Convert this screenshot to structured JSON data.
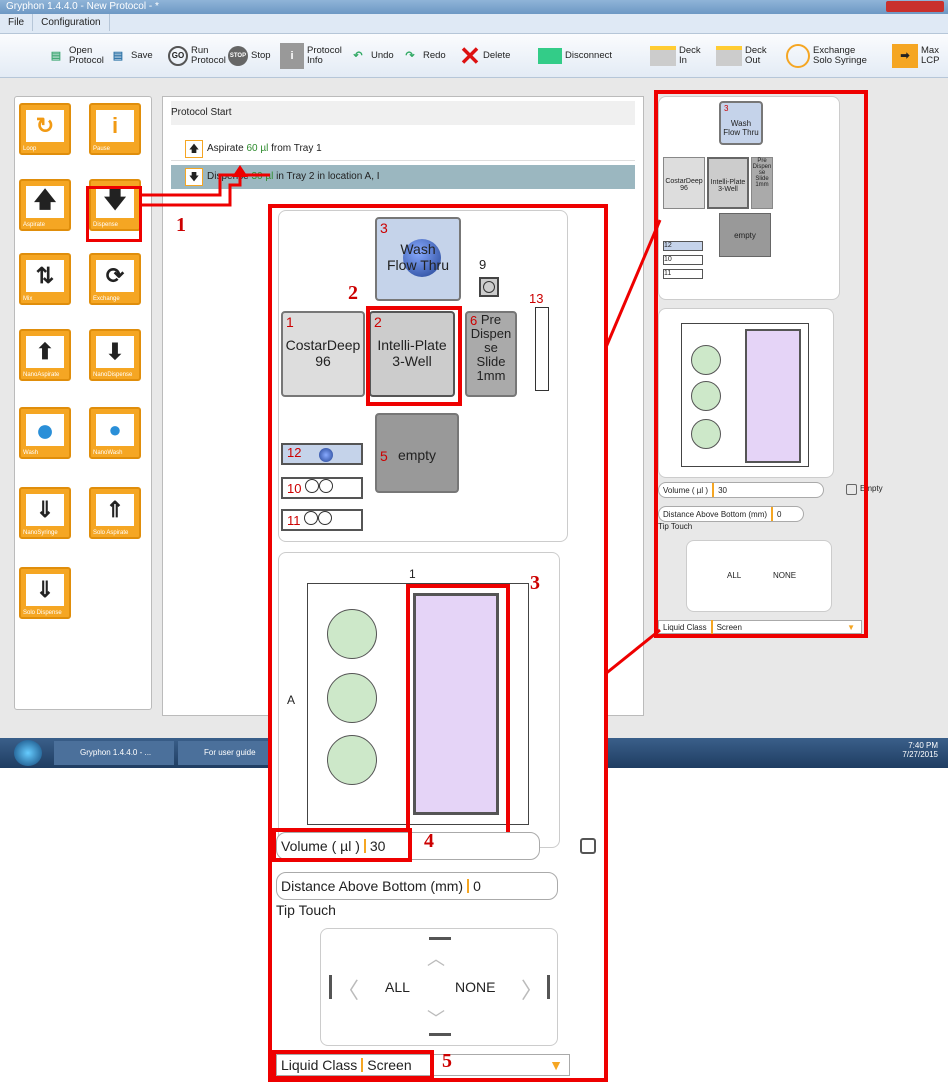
{
  "window": {
    "title": "Gryphon 1.4.4.0 - New Protocol - *"
  },
  "menu": [
    "File",
    "Configuration"
  ],
  "toolbar": [
    {
      "label": "Open\nProtocol",
      "icon": "open-icon"
    },
    {
      "label": "Save",
      "icon": "save-icon"
    },
    {
      "label": "Run\nProtocol",
      "icon": "go-icon",
      "glyph": "GO"
    },
    {
      "label": "Stop",
      "icon": "stop-icon",
      "glyph": "STOP"
    },
    {
      "label": "Protocol\nInfo",
      "icon": "info-icon",
      "glyph": "i"
    },
    {
      "label": "Undo",
      "icon": "undo-icon"
    },
    {
      "label": "Redo",
      "icon": "redo-icon"
    },
    {
      "label": "Delete",
      "icon": "delete-icon",
      "glyph": "✕"
    },
    {
      "label": "Disconnect",
      "icon": "disconnect-icon"
    },
    {
      "label": "Deck\nIn",
      "icon": "deck-in-icon"
    },
    {
      "label": "Deck\nOut",
      "icon": "deck-out-icon"
    },
    {
      "label": "Exchange\nSolo Syringe",
      "icon": "exchange-icon"
    },
    {
      "label": "Max\nLCP",
      "icon": "max-lcp-icon",
      "glyph": "➡"
    }
  ],
  "tools": [
    {
      "label": "Loop",
      "glyph": "↻"
    },
    {
      "label": "Pause",
      "glyph": "i"
    },
    {
      "label": "Aspirate",
      "glyph": "🡅"
    },
    {
      "label": "Dispense",
      "glyph": "🡇"
    },
    {
      "label": "Mix",
      "glyph": "⇅"
    },
    {
      "label": "Exchange",
      "glyph": "⟳"
    },
    {
      "label": "NanoAspirate",
      "glyph": "⬆"
    },
    {
      "label": "NanoDispense",
      "glyph": "⬇"
    },
    {
      "label": "Wash",
      "glyph": "●"
    },
    {
      "label": "NanoWash",
      "glyph": "●"
    },
    {
      "label": "NanoSyringe",
      "glyph": "⇓"
    },
    {
      "label": "Solo Aspirate",
      "glyph": "⇑"
    },
    {
      "label": "Solo Dispense",
      "glyph": "⇓"
    }
  ],
  "protocol": {
    "header": "Protocol Start",
    "steps": [
      {
        "pre": "Aspirate ",
        "vol": "60 µl",
        "post": " from Tray 1"
      },
      {
        "pre": "Dispense ",
        "vol": "30 µl",
        "post": " in Tray 2 in location A, I"
      }
    ]
  },
  "deck": {
    "wash": {
      "num": "3",
      "label": "Wash\nFlow Thru"
    },
    "p9": "9",
    "p13": "13",
    "costar": {
      "num": "1",
      "label": "CostarDeep\n96"
    },
    "intelli": {
      "num": "2",
      "label": "Intelli-Plate\n3-Well"
    },
    "pre": {
      "num": "6",
      "label": "Pre\nDispen\nse\nSlide\n1mm"
    },
    "empty": {
      "num": "5",
      "label": "empty"
    },
    "s12": "12",
    "s10": "10",
    "s11": "11"
  },
  "plate_view": {
    "col": "1",
    "row": "A"
  },
  "form": {
    "volume_label": "Volume ( µl )",
    "volume_value": "30",
    "dist_label": "Distance Above Bottom (mm)",
    "dist_value": "0",
    "tip_touch": "Tip Touch",
    "all": "ALL",
    "none": "NONE",
    "liquid_label": "Liquid Class",
    "liquid_value": "Screen",
    "empty_label": "Empty"
  },
  "taskbar": {
    "item1": "Gryphon 1.4.4.0 - ...",
    "item2": "For user guide",
    "time": "7:40 PM",
    "date": "7/27/2015"
  },
  "callouts": [
    "1",
    "2",
    "3",
    "4",
    "5"
  ],
  "colors": {
    "accent": "#f5a623",
    "callout": "#ee0000",
    "well": "#e5d4f7"
  }
}
